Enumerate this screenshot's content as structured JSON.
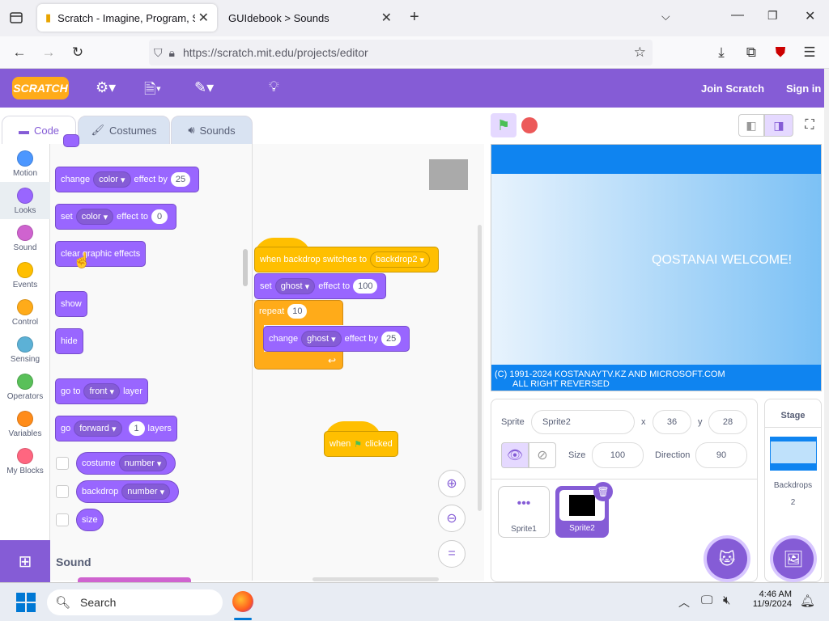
{
  "browser": {
    "tabs": [
      {
        "title": "Scratch - Imagine, Program, Sh",
        "active": true
      },
      {
        "title": "GUIdebook > Sounds",
        "active": false
      }
    ],
    "new_tab": "+",
    "url": "https://scratch.mit.edu/projects/editor"
  },
  "header": {
    "logo": "SCRATCH",
    "join": "Join Scratch",
    "signin": "Sign in"
  },
  "editor_tabs": [
    {
      "label": "Code",
      "icon": "code-icon",
      "active": true
    },
    {
      "label": "Costumes",
      "icon": "brush-icon",
      "active": false
    },
    {
      "label": "Sounds",
      "icon": "speaker-icon",
      "active": false
    }
  ],
  "categories": [
    {
      "label": "Motion",
      "color": "#4c97ff"
    },
    {
      "label": "Looks",
      "color": "#9966ff",
      "selected": true
    },
    {
      "label": "Sound",
      "color": "#cf63cf"
    },
    {
      "label": "Events",
      "color": "#ffbf00"
    },
    {
      "label": "Control",
      "color": "#ffab19"
    },
    {
      "label": "Sensing",
      "color": "#5cb1d6"
    },
    {
      "label": "Operators",
      "color": "#59c059"
    },
    {
      "label": "Variables",
      "color": "#ff8c1a"
    },
    {
      "label": "My Blocks",
      "color": "#ff6680"
    }
  ],
  "palette": {
    "change_effect": {
      "a": "change",
      "dd": "color",
      "b": "effect by",
      "val": "25"
    },
    "set_effect": {
      "a": "set",
      "dd": "color",
      "b": "effect to",
      "val": "0"
    },
    "clear": "clear graphic effects",
    "show": "show",
    "hide": "hide",
    "goto": {
      "a": "go to",
      "dd": "front",
      "b": "layer"
    },
    "go": {
      "a": "go",
      "dd": "forward",
      "val": "1",
      "b": "layers"
    },
    "costume": {
      "a": "costume",
      "dd": "number"
    },
    "backdrop": {
      "a": "backdrop",
      "dd": "number"
    },
    "size": "size",
    "sound_heading": "Sound"
  },
  "script": {
    "hat": {
      "a": "when backdrop switches to",
      "dd": "backdrop2"
    },
    "set": {
      "a": "set",
      "dd": "ghost",
      "b": "effect to",
      "val": "100"
    },
    "repeat": {
      "a": "repeat",
      "val": "10"
    },
    "change": {
      "a": "change",
      "dd": "ghost",
      "b": "effect by",
      "val": "25"
    },
    "flag_hat": {
      "a": "when",
      "b": "clicked"
    }
  },
  "stage": {
    "welcome": "QOSTANAI WELCOME!",
    "copyright_1": "(C) 1991-2024 KOSTANAYTV.KZ AND MICROSOFT.COM",
    "copyright_2": "ALL RIGHT REVERSED"
  },
  "sprite_info": {
    "sprite_label": "Sprite",
    "sprite_name": "Sprite2",
    "x_label": "x",
    "x": "36",
    "y_label": "y",
    "y": "28",
    "size_label": "Size",
    "size": "100",
    "direction_label": "Direction",
    "direction": "90"
  },
  "sprites": [
    {
      "name": "Sprite1",
      "selected": false
    },
    {
      "name": "Sprite2",
      "selected": true
    }
  ],
  "stage_pane": {
    "title": "Stage",
    "backdrops_label": "Backdrops",
    "backdrops_count": "2"
  },
  "taskbar": {
    "search": "Search",
    "time": "4:46 AM",
    "date": "11/9/2024"
  },
  "colors": {
    "scratch_purple": "#855cd6",
    "looks": "#9966ff",
    "events": "#ffbf00",
    "control": "#ffab19",
    "stage_banner": "#0f84f0"
  }
}
